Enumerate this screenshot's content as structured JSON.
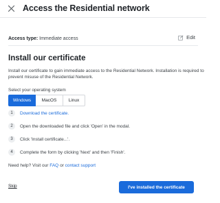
{
  "header": {
    "title": "Access the Residential network",
    "close_icon": "close-icon"
  },
  "access": {
    "label": "Access type:",
    "value": "Immediate access",
    "edit_label": "Edit",
    "edit_icon": "edit-icon"
  },
  "install": {
    "title": "Install our certificate",
    "description": "Install our certificate to gain immediate access to the Residential Network. Installation is required to prevent misuse of the Residential Network."
  },
  "os": {
    "label": "Select your operating system",
    "options": [
      "Windows",
      "MacOS",
      "Linux"
    ],
    "selected": "Windows",
    "active_color": "#1a6bdb"
  },
  "steps": [
    {
      "num": "1",
      "text": "Download the certificate."
    },
    {
      "num": "2",
      "text": "Open the downloaded file and click 'Open' in the modal."
    },
    {
      "num": "3",
      "text": "Click 'Install certificate...'."
    },
    {
      "num": "4",
      "text": "Complete the form by clicking 'Next' and then 'Finish'."
    }
  ],
  "help": {
    "prefix": "Need help? Visit our",
    "faq": "FAQ",
    "middle": "or",
    "contact": "contact support"
  },
  "footer": {
    "skip": "Skip",
    "primary": "I've installed the certificate"
  }
}
